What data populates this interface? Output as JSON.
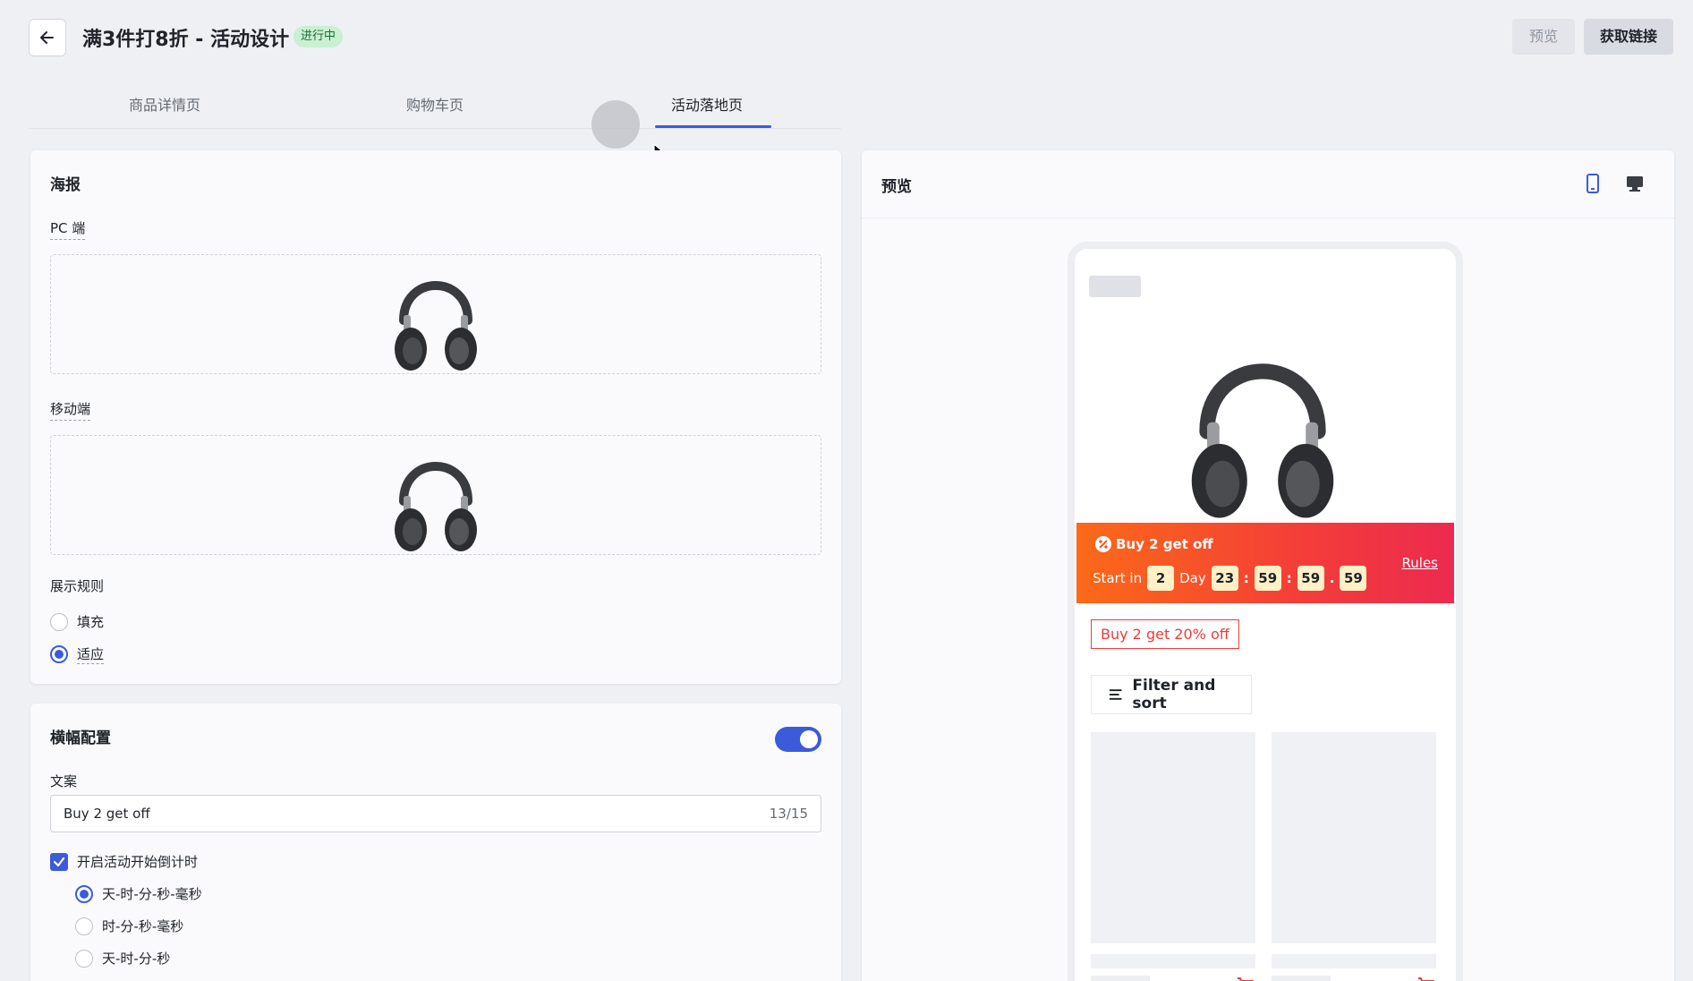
{
  "header": {
    "title": "满3件打8折 - 活动设计",
    "status": "进行中",
    "preview_label": "预览",
    "get_link_label": "获取链接"
  },
  "tabs": [
    {
      "label": "商品详情页",
      "active": false
    },
    {
      "label": "购物车页",
      "active": false
    },
    {
      "label": "活动落地页",
      "active": true
    }
  ],
  "poster": {
    "title": "海报",
    "pc_label": "PC 端",
    "mobile_label": "移动端",
    "display_rule_label": "展示规则",
    "display_rules": [
      {
        "label": "填充",
        "checked": false
      },
      {
        "label": "适应",
        "checked": true
      }
    ]
  },
  "banner": {
    "title": "横幅配置",
    "enabled": true,
    "copy_label": "文案",
    "copy_value": "Buy 2 get off",
    "char_count": "13/15",
    "countdown_label": "开启活动开始倒计时",
    "countdown_enabled": true,
    "formats": [
      {
        "label": "天-时-分-秒-毫秒",
        "checked": true
      },
      {
        "label": "时-分-秒-毫秒",
        "checked": false
      },
      {
        "label": "天-时-分-秒",
        "checked": false
      }
    ]
  },
  "preview": {
    "title": "预览",
    "promo_title": "Buy 2 get off",
    "start_in": "Start in",
    "days": "2",
    "day_label": "Day",
    "hours": "23",
    "minutes": "59",
    "seconds": "59",
    "ms": "59",
    "rules": "Rules",
    "offer_tag": "Buy 2 get 20% off",
    "filter_label": "Filter and sort"
  },
  "colors": {
    "accent": "#3b5bdb",
    "badge_bg": "#c9f0d3",
    "promo_start": "#fb6a18",
    "promo_end": "#ec2a4f",
    "offer_red": "#ef3b3b"
  }
}
